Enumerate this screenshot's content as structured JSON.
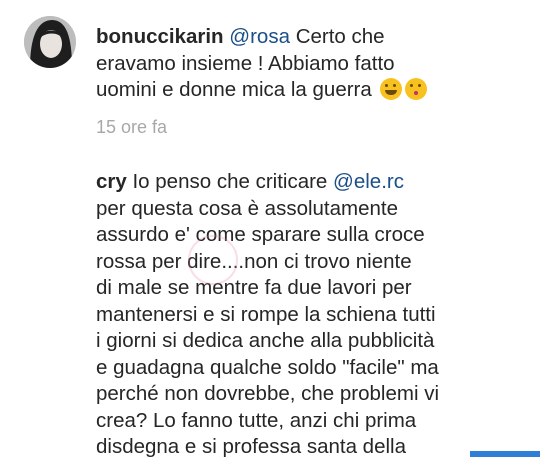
{
  "comments": [
    {
      "username": "bonuccikarin",
      "mention": "@rosa",
      "text_before": "      Certo che\neravamo insieme ! Abbiamo fatto\nuomini e donne mica la guerra",
      "emojis": [
        "grinning-sweat-emoji",
        "kiss-emoji"
      ],
      "time": "15 ore fa"
    },
    {
      "username": "cry",
      "text_before": "      Io penso che criticare ",
      "mention": "@ele.rc",
      "text_after": "\nper questa cosa è assolutamente\nassurdo e' come sparare sulla croce\nrossa per dire....non ci trovo niente\ndi male se mentre fa due lavori per\nmantenersi e si rompe la schiena tutti\ni giorni si dedica anche alla pubblicità\ne guadagna qualche soldo \"facile\" ma\nperché non dovrebbe, che problemi vi\ncrea? Lo fanno tutte, anzi chi prima\ndisdegna e si professa santa della"
    }
  ],
  "colors": {
    "mention": "#1b4f8a",
    "meta": "#a8a8a8",
    "scrollbar": "#2f7fd6"
  }
}
